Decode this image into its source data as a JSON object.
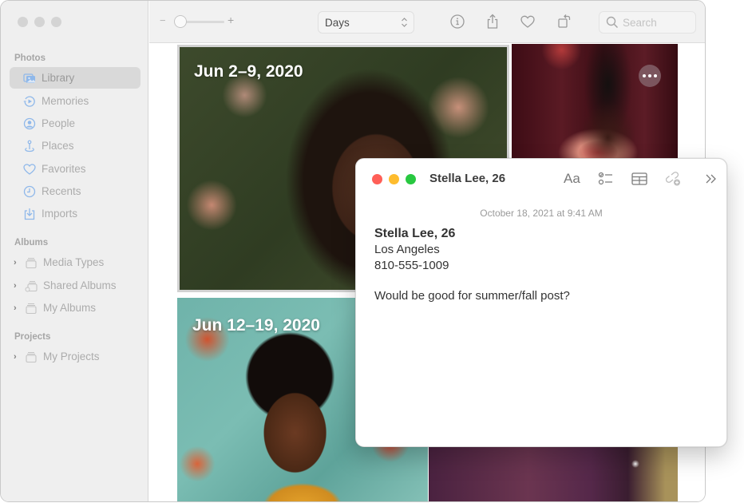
{
  "sidebar": {
    "sections": [
      {
        "title": "Photos",
        "items": [
          {
            "label": "Library",
            "icon": "library-icon",
            "active": true
          },
          {
            "label": "Memories",
            "icon": "memories-icon"
          },
          {
            "label": "People",
            "icon": "people-icon"
          },
          {
            "label": "Places",
            "icon": "places-icon"
          },
          {
            "label": "Favorites",
            "icon": "heart-icon"
          },
          {
            "label": "Recents",
            "icon": "clock-icon"
          },
          {
            "label": "Imports",
            "icon": "import-icon"
          }
        ]
      },
      {
        "title": "Albums",
        "items": [
          {
            "label": "Media Types",
            "icon": "album-stack-icon"
          },
          {
            "label": "Shared Albums",
            "icon": "shared-album-icon"
          },
          {
            "label": "My Albums",
            "icon": "album-stack-icon"
          }
        ]
      },
      {
        "title": "Projects",
        "items": [
          {
            "label": "My Projects",
            "icon": "album-stack-icon"
          }
        ]
      }
    ]
  },
  "toolbar": {
    "zoom_minus": "−",
    "zoom_plus": "+",
    "zoom_level": 0.1,
    "view_select": "Days",
    "search_placeholder": "Search",
    "icons": [
      "info-icon",
      "share-icon",
      "heart-icon",
      "rotate-icon"
    ]
  },
  "grid": {
    "groups": [
      {
        "date": "Jun 2–9, 2020"
      },
      {
        "date": "Jun 12–19, 2020"
      }
    ],
    "more_button": "•••"
  },
  "note": {
    "title": "Stella Lee, 26",
    "toolbar": [
      "format-text-icon",
      "checklist-icon",
      "table-icon",
      "collaborate-icon",
      "more-chevrons-icon"
    ],
    "format_label": "Aa",
    "timestamp": "October 18, 2021 at 9:41 AM",
    "heading": "Stella Lee, 26",
    "lines": [
      "Los Angeles",
      "810-555-1009"
    ],
    "comment": "Would be good for summer/fall post?",
    "lights": {
      "close": "#ff5f57",
      "minimize": "#febc2e",
      "zoom": "#28c840"
    }
  },
  "colors": {
    "sidebar_bg": "#efefef",
    "sidebar_icon": "#8fb8ea",
    "sidebar_text": "#acacac"
  }
}
